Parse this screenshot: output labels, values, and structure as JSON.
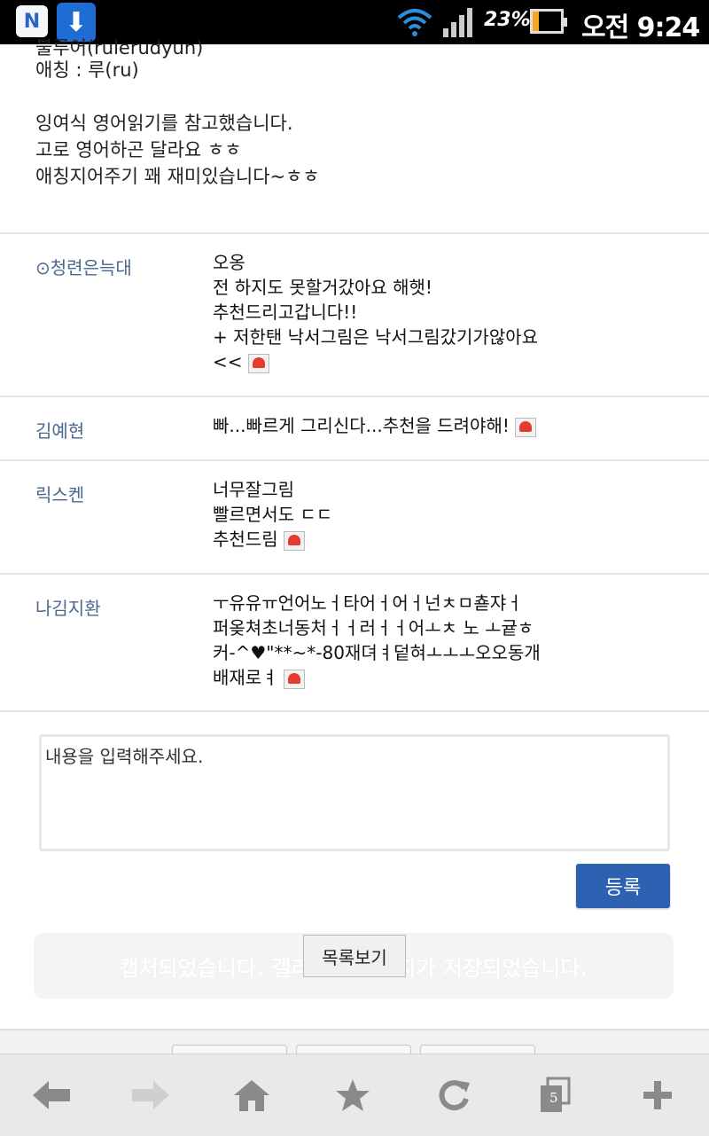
{
  "status_bar": {
    "battery_percent": "23%",
    "battery_level": 0.23,
    "time": "오전 9:24",
    "icons": [
      "naver-n-icon",
      "download-icon",
      "wifi-icon",
      "signal-icon",
      "battery-icon"
    ]
  },
  "post": {
    "partial_line": "불루어(rulerudyun)",
    "intro_lines": [
      "애칭 : 루(ru)",
      "",
      "잉여식 영어읽기를 참고했습니다.",
      "고로 영어하곤 달라요 ㅎㅎ",
      "애칭지어주기 꽤 재미있습니다~ㅎㅎ"
    ]
  },
  "comments": [
    {
      "author": "⊙청련은늑대",
      "lines": [
        "오옹",
        "전 하지도 못할거갔아요 해햇!",
        "추천드리고갑니다!!",
        "+ 저한탠 낙서그림은 낙서그림갔기가않아요",
        "<<"
      ]
    },
    {
      "author": "김예현",
      "lines": [
        "빠...빠르게 그리신다...추천을 드려야해!"
      ]
    },
    {
      "author": "릭스켄",
      "lines": [
        "너무잘그림",
        "빨르면서도 ㄷㄷ",
        "추천드림"
      ]
    },
    {
      "author": "나김지환",
      "lines": [
        "ㅜ유유ㅠ언어노ㅓ타어ㅓ어ㅓ넌ㅊㅁ쵿쟈ㅓ",
        "퍼옺쳐초너동처ㅓㅓ러ㅓㅓ어ㅗㅊ 노 ㅗ귵ㅎ",
        "커-^♥\"**~*-80재뎌ㅕ덭혀ㅗㅗㅗ오오동개",
        "배재로ㅕ"
      ]
    }
  ],
  "reply": {
    "placeholder": "내용을 입력해주세요.",
    "submit_label": "등록"
  },
  "list_button_label": "목록보기",
  "toast_message": "캡처되었습니다. 갤러리에 이미지가 저장되었습니다.",
  "browser_toolbar": {
    "tab_count": "5",
    "buttons": [
      "back-icon",
      "forward-icon",
      "home-icon",
      "bookmark-star-icon",
      "refresh-icon",
      "tabs-icon",
      "new-tab-icon"
    ]
  }
}
